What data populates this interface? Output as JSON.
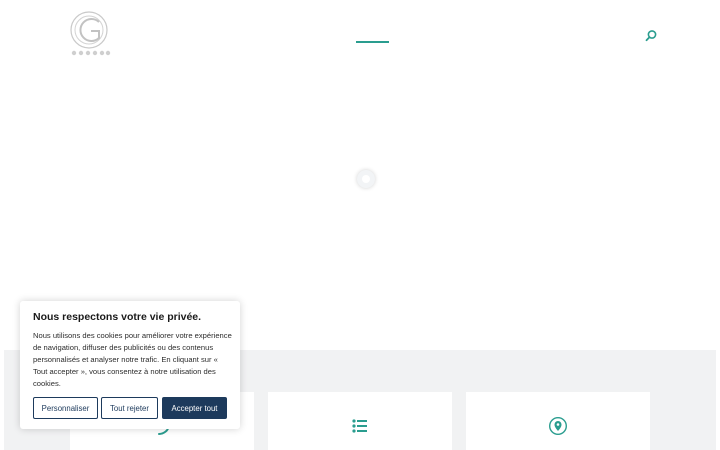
{
  "header": {
    "logo_icon": "circle-g-logo-icon",
    "search_icon": "search-icon",
    "accent_color": "#2a9d8f"
  },
  "cookie_banner": {
    "title": "Nous respectons votre vie privée.",
    "text": "Nous utilisons des cookies pour améliorer votre expérience de navigation, diffuser des publicités ou des contenus personnalisés et analyser notre trafic. En cliquant sur « Tout accepter », vous consentez à notre utilisation des cookies.",
    "customize_label": "Personnaliser",
    "reject_label": "Tout rejeter",
    "accept_label": "Accepter tout",
    "primary_color": "#1d3a5c"
  },
  "cards": [
    {
      "icon": "phone-icon"
    },
    {
      "icon": "list-icon"
    },
    {
      "icon": "location-pin-icon"
    }
  ]
}
